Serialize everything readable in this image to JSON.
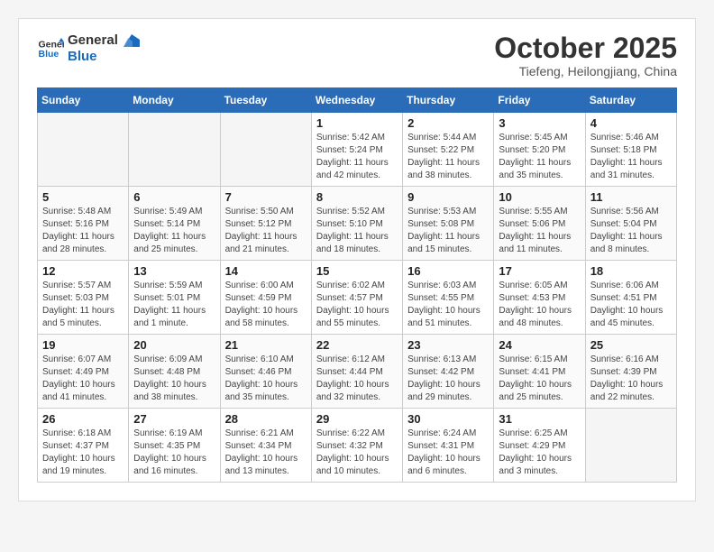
{
  "header": {
    "logo_line1": "General",
    "logo_line2": "Blue",
    "month_title": "October 2025",
    "location": "Tiefeng, Heilongjiang, China"
  },
  "weekdays": [
    "Sunday",
    "Monday",
    "Tuesday",
    "Wednesday",
    "Thursday",
    "Friday",
    "Saturday"
  ],
  "weeks": [
    [
      {
        "day": "",
        "sunrise": "",
        "sunset": "",
        "daylight": ""
      },
      {
        "day": "",
        "sunrise": "",
        "sunset": "",
        "daylight": ""
      },
      {
        "day": "",
        "sunrise": "",
        "sunset": "",
        "daylight": ""
      },
      {
        "day": "1",
        "sunrise": "Sunrise: 5:42 AM",
        "sunset": "Sunset: 5:24 PM",
        "daylight": "Daylight: 11 hours and 42 minutes."
      },
      {
        "day": "2",
        "sunrise": "Sunrise: 5:44 AM",
        "sunset": "Sunset: 5:22 PM",
        "daylight": "Daylight: 11 hours and 38 minutes."
      },
      {
        "day": "3",
        "sunrise": "Sunrise: 5:45 AM",
        "sunset": "Sunset: 5:20 PM",
        "daylight": "Daylight: 11 hours and 35 minutes."
      },
      {
        "day": "4",
        "sunrise": "Sunrise: 5:46 AM",
        "sunset": "Sunset: 5:18 PM",
        "daylight": "Daylight: 11 hours and 31 minutes."
      }
    ],
    [
      {
        "day": "5",
        "sunrise": "Sunrise: 5:48 AM",
        "sunset": "Sunset: 5:16 PM",
        "daylight": "Daylight: 11 hours and 28 minutes."
      },
      {
        "day": "6",
        "sunrise": "Sunrise: 5:49 AM",
        "sunset": "Sunset: 5:14 PM",
        "daylight": "Daylight: 11 hours and 25 minutes."
      },
      {
        "day": "7",
        "sunrise": "Sunrise: 5:50 AM",
        "sunset": "Sunset: 5:12 PM",
        "daylight": "Daylight: 11 hours and 21 minutes."
      },
      {
        "day": "8",
        "sunrise": "Sunrise: 5:52 AM",
        "sunset": "Sunset: 5:10 PM",
        "daylight": "Daylight: 11 hours and 18 minutes."
      },
      {
        "day": "9",
        "sunrise": "Sunrise: 5:53 AM",
        "sunset": "Sunset: 5:08 PM",
        "daylight": "Daylight: 11 hours and 15 minutes."
      },
      {
        "day": "10",
        "sunrise": "Sunrise: 5:55 AM",
        "sunset": "Sunset: 5:06 PM",
        "daylight": "Daylight: 11 hours and 11 minutes."
      },
      {
        "day": "11",
        "sunrise": "Sunrise: 5:56 AM",
        "sunset": "Sunset: 5:04 PM",
        "daylight": "Daylight: 11 hours and 8 minutes."
      }
    ],
    [
      {
        "day": "12",
        "sunrise": "Sunrise: 5:57 AM",
        "sunset": "Sunset: 5:03 PM",
        "daylight": "Daylight: 11 hours and 5 minutes."
      },
      {
        "day": "13",
        "sunrise": "Sunrise: 5:59 AM",
        "sunset": "Sunset: 5:01 PM",
        "daylight": "Daylight: 11 hours and 1 minute."
      },
      {
        "day": "14",
        "sunrise": "Sunrise: 6:00 AM",
        "sunset": "Sunset: 4:59 PM",
        "daylight": "Daylight: 10 hours and 58 minutes."
      },
      {
        "day": "15",
        "sunrise": "Sunrise: 6:02 AM",
        "sunset": "Sunset: 4:57 PM",
        "daylight": "Daylight: 10 hours and 55 minutes."
      },
      {
        "day": "16",
        "sunrise": "Sunrise: 6:03 AM",
        "sunset": "Sunset: 4:55 PM",
        "daylight": "Daylight: 10 hours and 51 minutes."
      },
      {
        "day": "17",
        "sunrise": "Sunrise: 6:05 AM",
        "sunset": "Sunset: 4:53 PM",
        "daylight": "Daylight: 10 hours and 48 minutes."
      },
      {
        "day": "18",
        "sunrise": "Sunrise: 6:06 AM",
        "sunset": "Sunset: 4:51 PM",
        "daylight": "Daylight: 10 hours and 45 minutes."
      }
    ],
    [
      {
        "day": "19",
        "sunrise": "Sunrise: 6:07 AM",
        "sunset": "Sunset: 4:49 PM",
        "daylight": "Daylight: 10 hours and 41 minutes."
      },
      {
        "day": "20",
        "sunrise": "Sunrise: 6:09 AM",
        "sunset": "Sunset: 4:48 PM",
        "daylight": "Daylight: 10 hours and 38 minutes."
      },
      {
        "day": "21",
        "sunrise": "Sunrise: 6:10 AM",
        "sunset": "Sunset: 4:46 PM",
        "daylight": "Daylight: 10 hours and 35 minutes."
      },
      {
        "day": "22",
        "sunrise": "Sunrise: 6:12 AM",
        "sunset": "Sunset: 4:44 PM",
        "daylight": "Daylight: 10 hours and 32 minutes."
      },
      {
        "day": "23",
        "sunrise": "Sunrise: 6:13 AM",
        "sunset": "Sunset: 4:42 PM",
        "daylight": "Daylight: 10 hours and 29 minutes."
      },
      {
        "day": "24",
        "sunrise": "Sunrise: 6:15 AM",
        "sunset": "Sunset: 4:41 PM",
        "daylight": "Daylight: 10 hours and 25 minutes."
      },
      {
        "day": "25",
        "sunrise": "Sunrise: 6:16 AM",
        "sunset": "Sunset: 4:39 PM",
        "daylight": "Daylight: 10 hours and 22 minutes."
      }
    ],
    [
      {
        "day": "26",
        "sunrise": "Sunrise: 6:18 AM",
        "sunset": "Sunset: 4:37 PM",
        "daylight": "Daylight: 10 hours and 19 minutes."
      },
      {
        "day": "27",
        "sunrise": "Sunrise: 6:19 AM",
        "sunset": "Sunset: 4:35 PM",
        "daylight": "Daylight: 10 hours and 16 minutes."
      },
      {
        "day": "28",
        "sunrise": "Sunrise: 6:21 AM",
        "sunset": "Sunset: 4:34 PM",
        "daylight": "Daylight: 10 hours and 13 minutes."
      },
      {
        "day": "29",
        "sunrise": "Sunrise: 6:22 AM",
        "sunset": "Sunset: 4:32 PM",
        "daylight": "Daylight: 10 hours and 10 minutes."
      },
      {
        "day": "30",
        "sunrise": "Sunrise: 6:24 AM",
        "sunset": "Sunset: 4:31 PM",
        "daylight": "Daylight: 10 hours and 6 minutes."
      },
      {
        "day": "31",
        "sunrise": "Sunrise: 6:25 AM",
        "sunset": "Sunset: 4:29 PM",
        "daylight": "Daylight: 10 hours and 3 minutes."
      },
      {
        "day": "",
        "sunrise": "",
        "sunset": "",
        "daylight": ""
      }
    ]
  ]
}
